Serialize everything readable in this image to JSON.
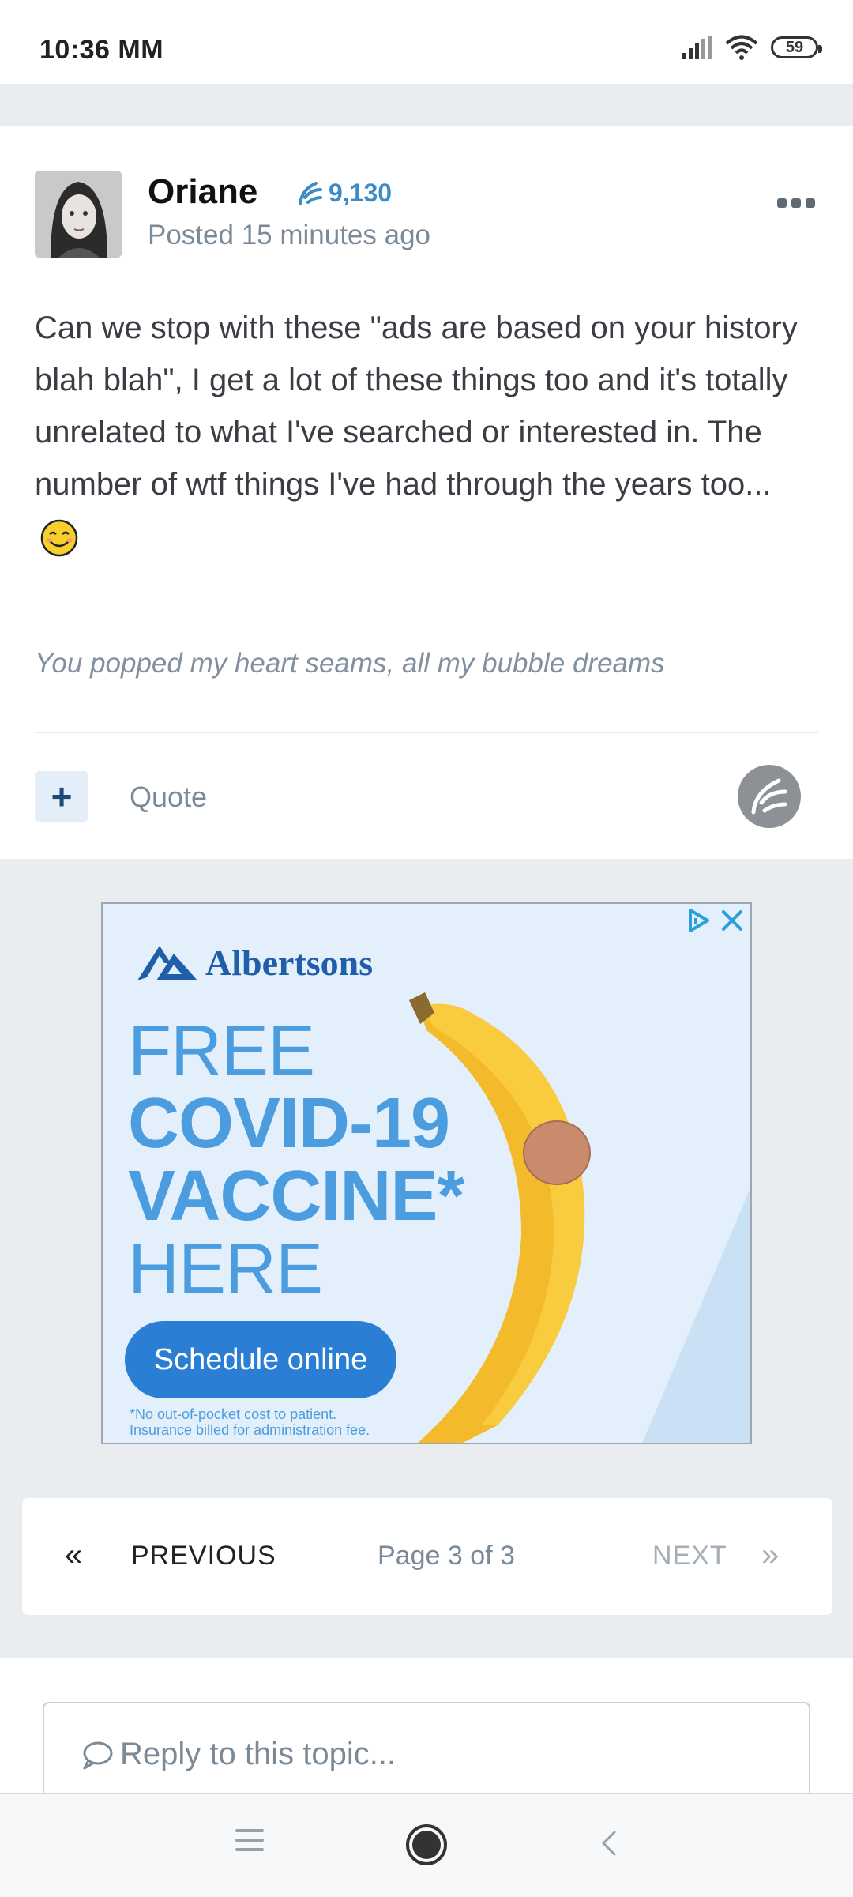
{
  "status_bar": {
    "time": "10:36 MM",
    "battery": "59"
  },
  "post": {
    "author": "Oriane",
    "reputation": "9,130",
    "posted": "Posted 15 minutes ago",
    "body": "Can we stop with these \"ads are based on your history blah blah\", I get a lot of these things too and it's totally unrelated to what I've searched or interested in. The number of wtf things I've had through the years too...",
    "signature": "You popped my heart seams, all my bubble dreams",
    "quote_label": "Quote",
    "plus_label": "+"
  },
  "ad": {
    "brand": "Albertsons",
    "headline_lines": [
      "FREE",
      "COVID-19",
      "VACCINE*",
      "HERE"
    ],
    "cta": "Schedule online",
    "disclaimer_1": "*No out-of-pocket cost to patient.",
    "disclaimer_2": "Insurance billed for administration fee."
  },
  "pagination": {
    "prev_icon": "«",
    "prev": "PREVIOUS",
    "page": "Page 3 of 3",
    "next": "NEXT",
    "next_icon": "»"
  },
  "reply": {
    "placeholder": "Reply to this topic..."
  },
  "colors": {
    "accent": "#3c8cc8",
    "ad_blue": "#2a7fd4",
    "page_bg": "#e9edf0"
  }
}
